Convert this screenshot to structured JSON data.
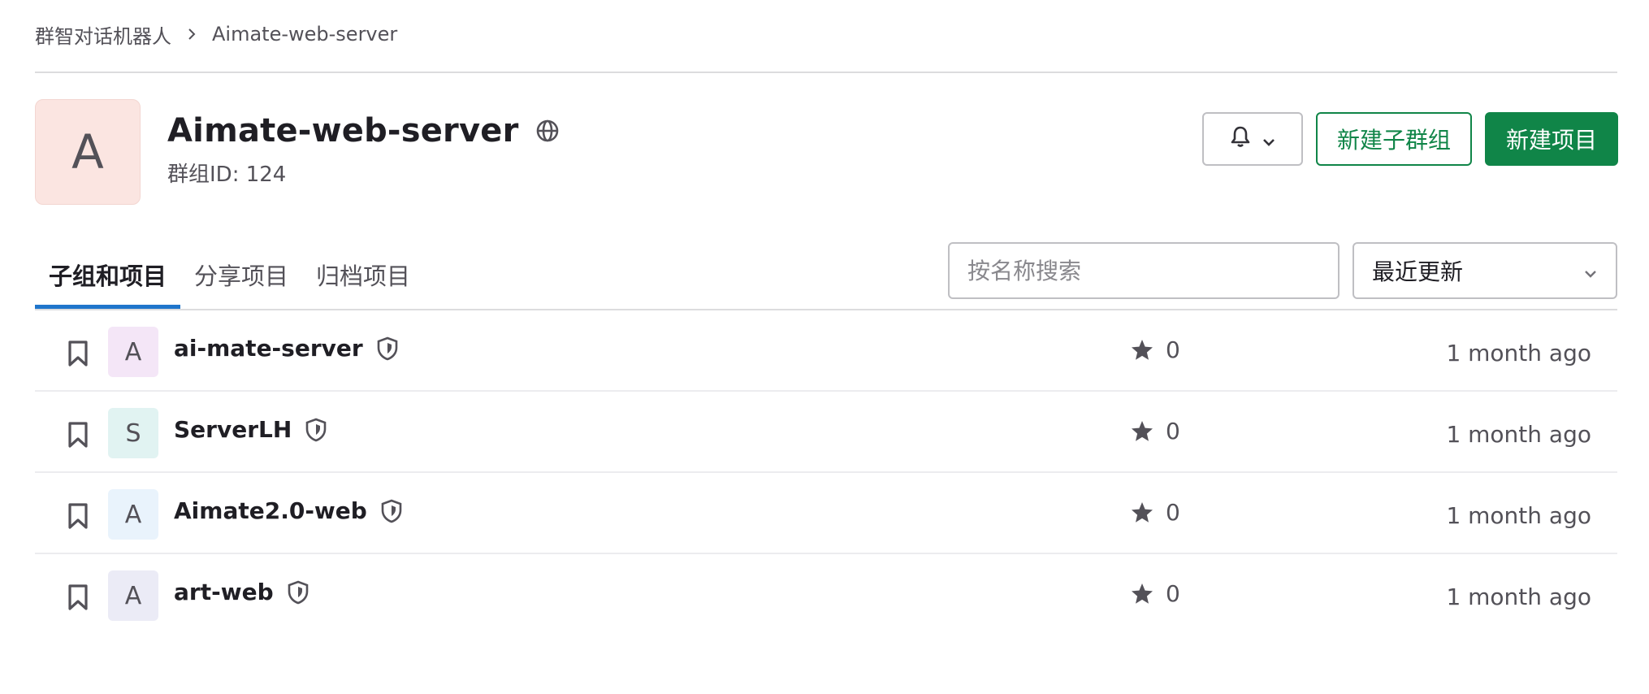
{
  "breadcrumb": {
    "parent": "群智对话机器人",
    "current": "Aimate-web-server"
  },
  "group": {
    "avatar_letter": "A",
    "avatar_color": "#fbe5e1",
    "name": "Aimate-web-server",
    "id_text": "群组ID: 124",
    "visibility_icon": "globe-icon"
  },
  "actions": {
    "notification_icon": "bell-icon",
    "new_subgroup": "新建子群组",
    "new_project": "新建项目",
    "primary_color": "#108548"
  },
  "tabs": [
    {
      "label": "子组和项目",
      "active": true
    },
    {
      "label": "分享项目",
      "active": false
    },
    {
      "label": "归档项目",
      "active": false
    }
  ],
  "search": {
    "placeholder": "按名称搜索"
  },
  "sort": {
    "selected": "最近更新"
  },
  "projects": [
    {
      "letter": "A",
      "avatar_color": "#f4e6f7",
      "name": "ai-mate-server",
      "stars": "0",
      "updated": "1 month ago"
    },
    {
      "letter": "S",
      "avatar_color": "#e1f3f2",
      "name": "ServerLH",
      "stars": "0",
      "updated": "1 month ago"
    },
    {
      "letter": "A",
      "avatar_color": "#e9f3fc",
      "name": "Aimate2.0-web",
      "stars": "0",
      "updated": "1 month ago"
    },
    {
      "letter": "A",
      "avatar_color": "#ebebf6",
      "name": "art-web",
      "stars": "0",
      "updated": "1 month ago"
    }
  ]
}
